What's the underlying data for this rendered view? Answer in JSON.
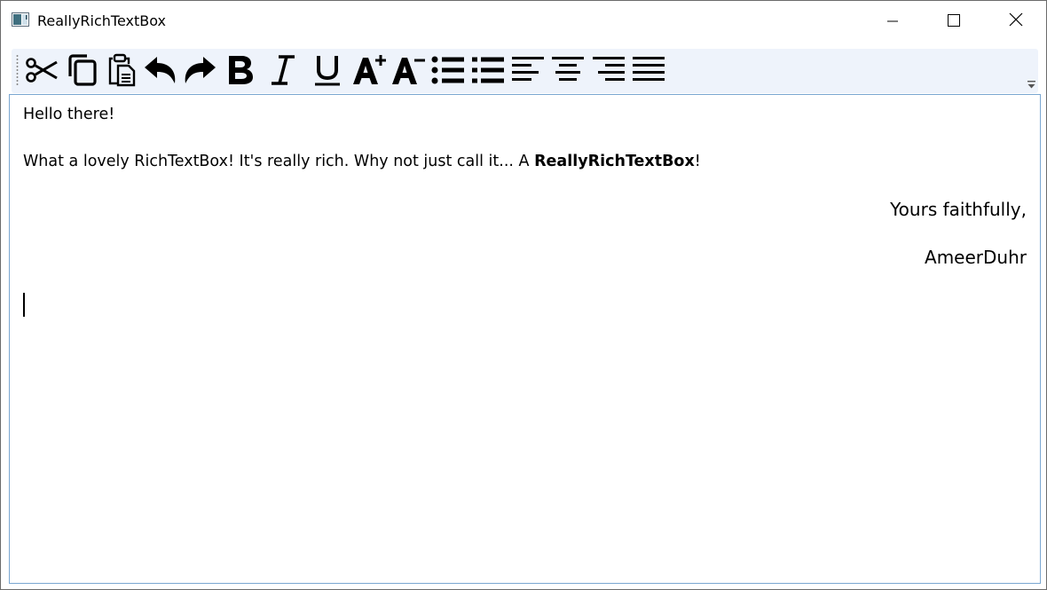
{
  "window": {
    "title": "ReallyRichTextBox",
    "controls": {
      "minimize": "minimize-icon",
      "maximize": "maximize-icon",
      "close": "close-icon"
    }
  },
  "toolbar": {
    "buttons": [
      {
        "id": "cut",
        "icon": "scissors-icon"
      },
      {
        "id": "copy",
        "icon": "copy-icon"
      },
      {
        "id": "paste",
        "icon": "paste-icon"
      },
      {
        "id": "undo",
        "icon": "undo-icon"
      },
      {
        "id": "redo",
        "icon": "redo-icon"
      },
      {
        "id": "bold",
        "icon": "bold-icon"
      },
      {
        "id": "italic",
        "icon": "italic-icon"
      },
      {
        "id": "underline",
        "icon": "underline-icon"
      },
      {
        "id": "increase-font",
        "icon": "font-increase-icon"
      },
      {
        "id": "decrease-font",
        "icon": "font-decrease-icon"
      },
      {
        "id": "bullets",
        "icon": "bulleted-list-icon"
      },
      {
        "id": "numbering",
        "icon": "numbered-list-icon"
      },
      {
        "id": "align-left",
        "icon": "align-left-icon"
      },
      {
        "id": "align-center",
        "icon": "align-center-icon"
      },
      {
        "id": "align-right",
        "icon": "align-right-icon"
      },
      {
        "id": "justify",
        "icon": "align-justify-icon"
      }
    ],
    "overflow_icon": "toolbar-overflow-icon"
  },
  "document": {
    "greeting": "Hello there!",
    "body_before": "What a lovely RichTextBox! It's really rich. Why not just call it... A ",
    "body_bold": "ReallyRichTextBox",
    "body_after": "!",
    "closing": "Yours faithfully,",
    "signature": "AmeerDuhr"
  },
  "colors": {
    "toolbar_background": "#eef3fb",
    "editor_border": "#7aa7d1"
  }
}
